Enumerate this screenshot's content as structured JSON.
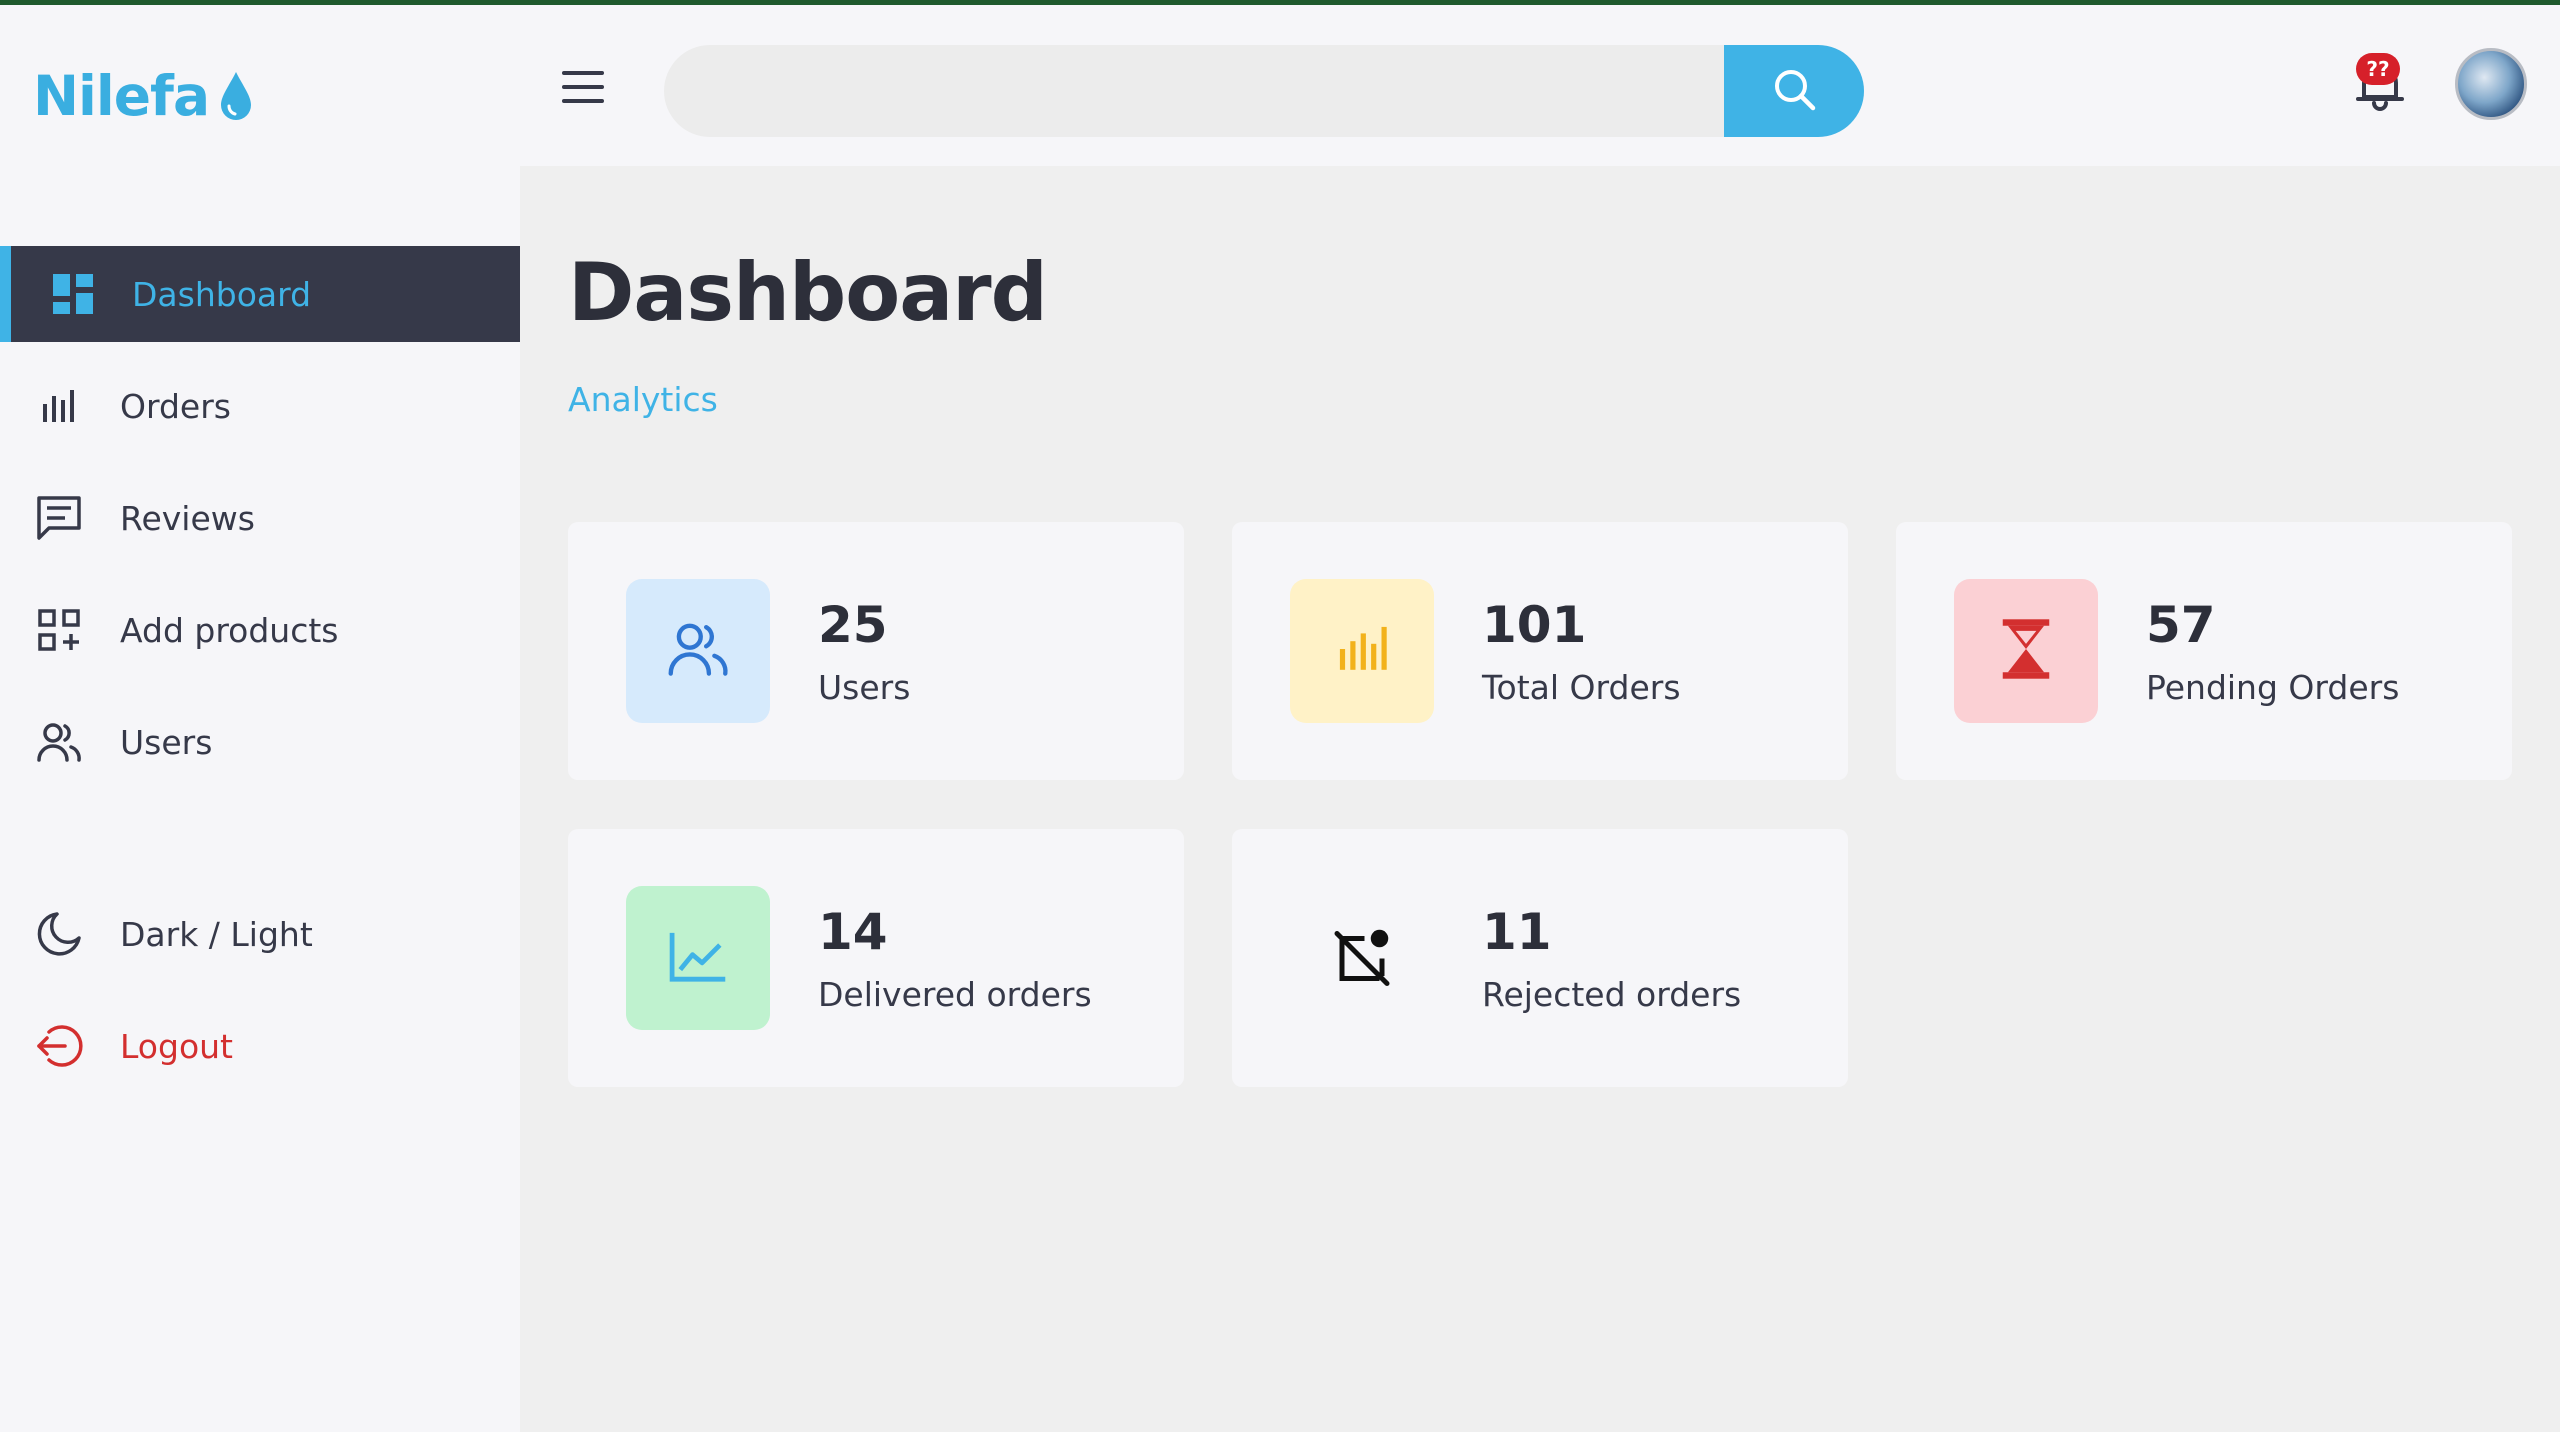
{
  "app": {
    "brand": "Nilefa"
  },
  "header": {
    "search": {
      "placeholder": "",
      "value": ""
    },
    "notifications": {
      "badge": "??"
    }
  },
  "sidebar": {
    "items": [
      {
        "label": "Dashboard",
        "icon": "dashboard-icon",
        "active": true
      },
      {
        "label": "Orders",
        "icon": "bar-chart-icon"
      },
      {
        "label": "Reviews",
        "icon": "message-square-icon"
      },
      {
        "label": "Add products",
        "icon": "add-grid-icon"
      },
      {
        "label": "Users",
        "icon": "users-icon"
      },
      {
        "label": "Dark / Light",
        "icon": "moon-icon"
      },
      {
        "label": "Logout",
        "icon": "logout-icon"
      }
    ]
  },
  "main": {
    "title": "Dashboard",
    "subtitle": "Analytics",
    "cards": [
      {
        "value": "25",
        "label": "Users",
        "icon": "users-icon",
        "tile_color": "#d6eafc",
        "icon_color": "#2f76d2"
      },
      {
        "value": "101",
        "label": "Total Orders",
        "icon": "bar-chart-icon",
        "tile_color": "#fff2c7",
        "icon_color": "#f2b21b"
      },
      {
        "value": "57",
        "label": "Pending Orders",
        "icon": "hourglass-icon",
        "tile_color": "#fbd0d4",
        "icon_color": "#d32f2f"
      },
      {
        "value": "14",
        "label": "Delivered orders",
        "icon": "trend-up-icon",
        "tile_color": "#bff2cf",
        "icon_color": "#3fb3e6"
      },
      {
        "value": "11",
        "label": "Rejected orders",
        "icon": "cancelled-doc-icon",
        "tile_color": "#f6f6f9",
        "icon_color": "#111111"
      }
    ]
  },
  "colors": {
    "accent": "#3fb3e6",
    "sidebar_active_bg": "#363949",
    "danger": "#d32f2f",
    "text": "#363949"
  }
}
